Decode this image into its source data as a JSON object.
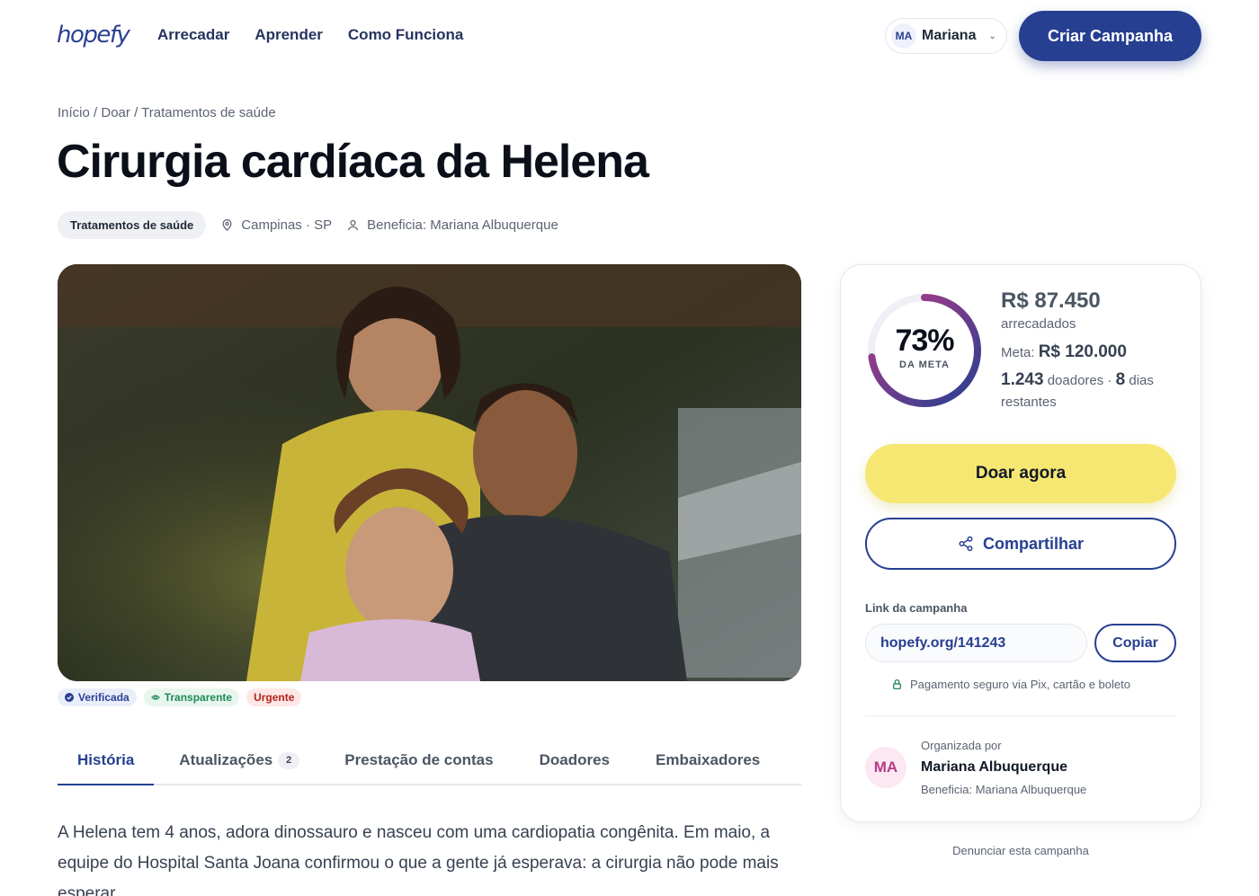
{
  "header": {
    "logo": "hopefy",
    "nav": [
      "Arrecadar",
      "Aprender",
      "Como Funciona"
    ],
    "user": {
      "initials": "MA",
      "name": "Mariana"
    },
    "create_button": "Criar Campanha"
  },
  "breadcrumb": {
    "home": "Início",
    "sep": "/",
    "donate": "Doar",
    "category": "Tratamentos de saúde"
  },
  "campaign": {
    "title": "Cirurgia cardíaca da Helena",
    "category": "Tratamentos de saúde",
    "location": "Campinas · SP",
    "beneficiary": "Beneficia: Mariana Albuquerque"
  },
  "badges": {
    "verified": "Verificada",
    "transparent": "Transparente",
    "urgent": "Urgente"
  },
  "tabs": {
    "story": "História",
    "updates": "Atualizações",
    "updates_count": "2",
    "accounts": "Prestação de contas",
    "donors": "Doadores",
    "ambassadors": "Embaixadores"
  },
  "story_text": "A Helena tem 4 anos, adora dinossauro e nasceu com uma cardiopatia congênita. Em maio, a equipe do Hospital Santa Joana confirmou o que a gente já esperava: a cirurgia não pode mais esperar.",
  "donation": {
    "progress": 0.73,
    "percent_label": "73%",
    "percent_caption": "DA META",
    "raised": "R$ 87.450",
    "raised_caption": "arrecadados",
    "goal_label": "Meta:",
    "goal": "R$ 120.000",
    "donors": "1.243",
    "donors_label": "doadores ·",
    "days": "8",
    "days_label": "dias restantes",
    "donate_button": "Doar agora",
    "share_button": "Compartilhar",
    "link_label": "Link da campanha",
    "link": "hopefy.org/141243",
    "copy_button": "Copiar",
    "secure_text": "Pagamento seguro via Pix, cartão e boleto",
    "organizer_caption": "Organizada por",
    "organizer_initials": "MA",
    "organizer_name": "Mariana Albuquerque",
    "organizer_beneficiary": "Beneficia: Mariana Albuquerque"
  },
  "report_link": "Denunciar esta campanha",
  "colors": {
    "brand": "#263f91",
    "donate": "#f6e772",
    "ring_start": "#263f91",
    "ring_end": "#b83a86"
  }
}
